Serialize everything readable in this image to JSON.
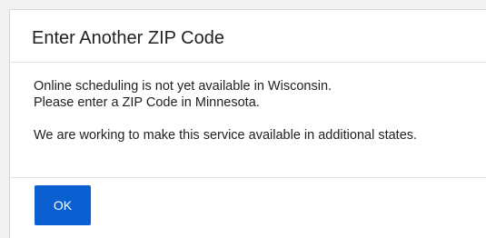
{
  "dialog": {
    "title": "Enter Another ZIP Code",
    "message_line1": "Online scheduling is not yet available in Wisconsin.",
    "message_line2": "Please enter a ZIP Code in Minnesota.",
    "message_line3": "We are working to make this service available in additional states.",
    "ok_label": "OK"
  },
  "colors": {
    "primary_button": "#0a5fd1",
    "backdrop": "#f2f2f2",
    "panel": "#ffffff"
  }
}
